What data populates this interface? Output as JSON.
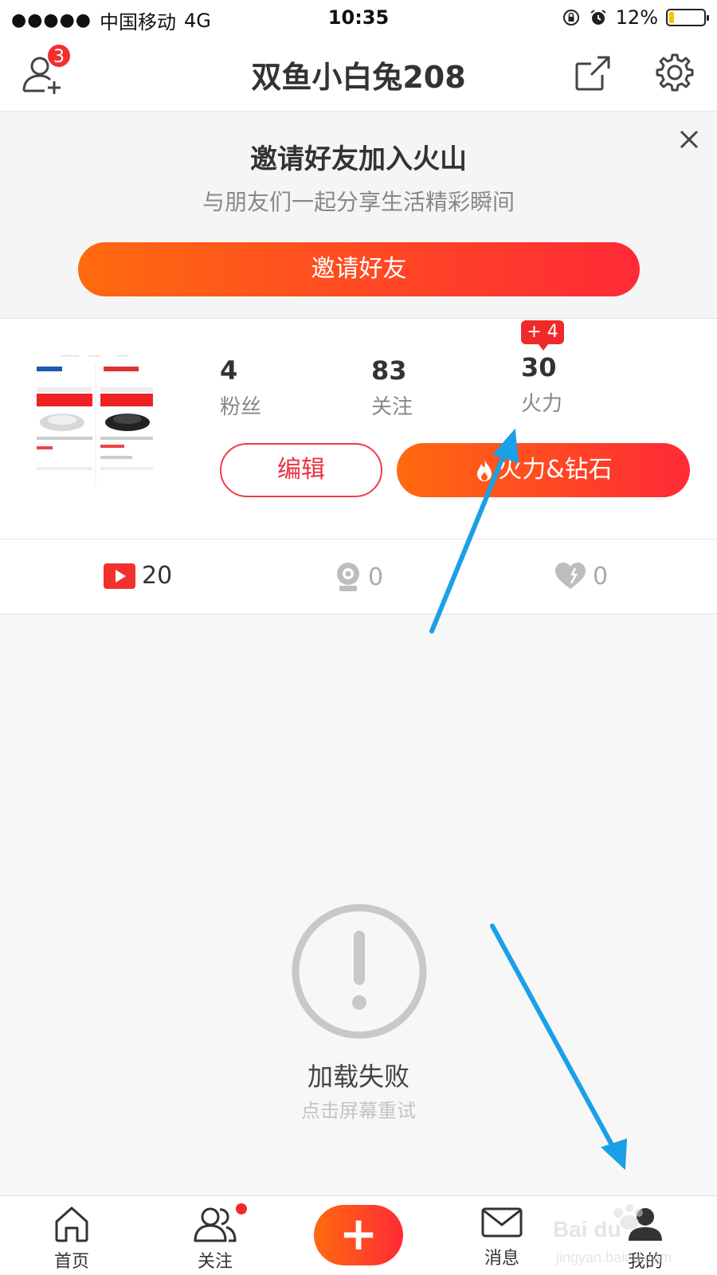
{
  "status_bar": {
    "signal": "●●●●●",
    "carrier": "中国移动",
    "network": "4G",
    "time": "10:35",
    "battery": "12%",
    "battery_level": 0.12
  },
  "header": {
    "title": "双鱼小白兔208",
    "friend_badge": "3"
  },
  "invite": {
    "title": "邀请好友加入火山",
    "subtitle": "与朋友们一起分享生活精彩瞬间",
    "button": "邀请好友"
  },
  "profile": {
    "stats": [
      {
        "value": "4",
        "label": "粉丝"
      },
      {
        "value": "83",
        "label": "关注"
      },
      {
        "value": "30",
        "label": "火力"
      }
    ],
    "fire_increment": "+ 4",
    "edit_button": "编辑",
    "fire_button": "火力&钻石"
  },
  "counts": {
    "videos": "20",
    "live": "0",
    "likes": "0"
  },
  "error": {
    "title": "加载失败",
    "subtitle": "点击屏幕重试"
  },
  "tabbar": {
    "items": [
      {
        "label": "首页"
      },
      {
        "label": "关注"
      },
      {
        "label": "消息"
      },
      {
        "label": "我的"
      }
    ]
  },
  "colors": {
    "accent_start": "#ff6a0f",
    "accent_end": "#ff2a36",
    "badge": "#f3302e",
    "annotation_arrow": "#1aa0e6"
  }
}
